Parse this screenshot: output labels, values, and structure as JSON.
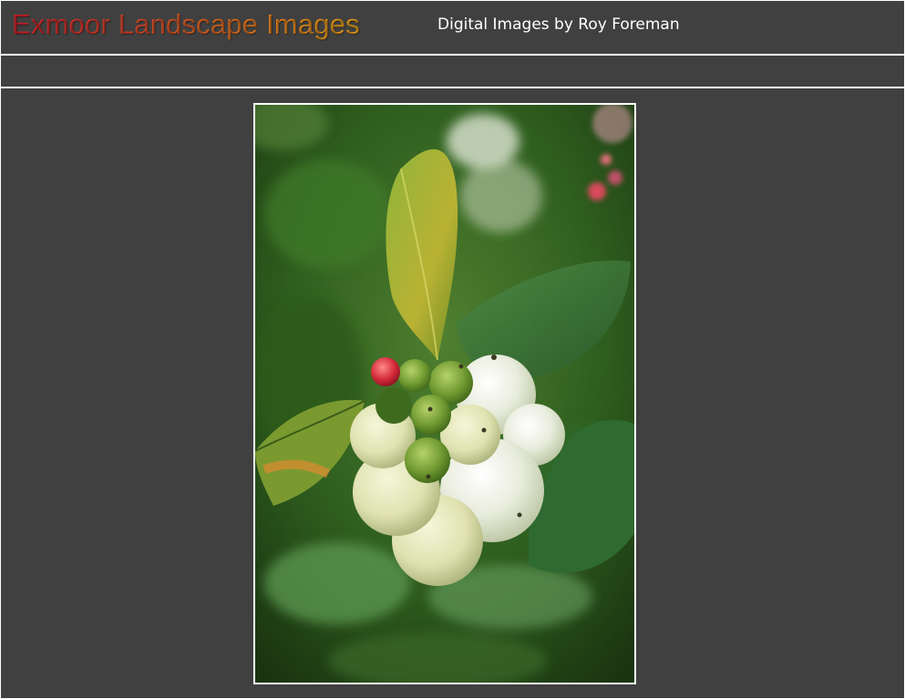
{
  "header": {
    "site_title": "Exmoor Landscape Images",
    "tagline": "Digital Images by Roy Foreman"
  },
  "colors": {
    "background": "#404040",
    "rule": "#ffffff",
    "title_gradient_start": "#d0202a",
    "title_gradient_end": "#f0a618"
  },
  "photo": {
    "subject_icon": "snowberry-photo"
  }
}
